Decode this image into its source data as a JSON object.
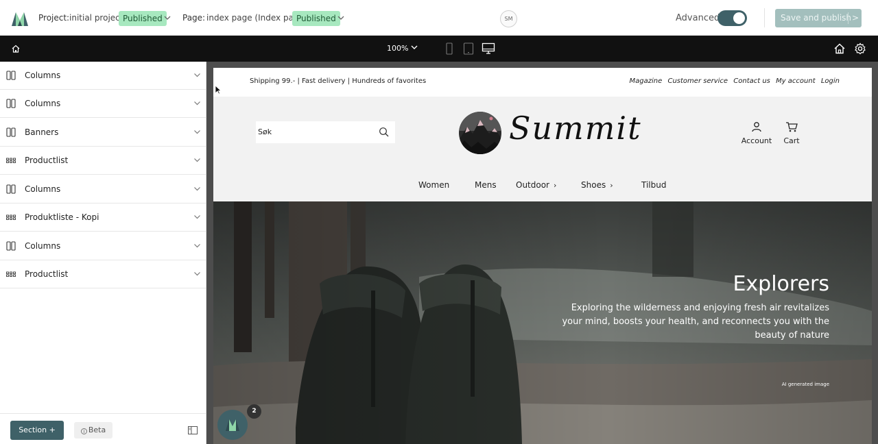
{
  "header": {
    "project_label": "Project:",
    "project_name": "initial project",
    "project_status": "Published",
    "page_label": "Page:",
    "page_name": "index page (Index page)",
    "page_status": "Published",
    "user_initials": "SM",
    "advanced_label": "Advanced",
    "advanced_on": true,
    "publish_label": "Save and publish",
    "publish_arrow": ">"
  },
  "toolbar": {
    "zoom": "100%",
    "devices": [
      "mobile-icon",
      "tablet-icon",
      "desktop-icon"
    ],
    "selected_device": "desktop"
  },
  "sidebar": {
    "sections": [
      {
        "label": "Columns",
        "icon": "columns-icon"
      },
      {
        "label": "Columns",
        "icon": "columns-icon"
      },
      {
        "label": "Banners",
        "icon": "columns-icon"
      },
      {
        "label": "Productlist",
        "icon": "grid-icon"
      },
      {
        "label": "Columns",
        "icon": "columns-icon"
      },
      {
        "label": "Produktliste - Kopi",
        "icon": "grid-icon"
      },
      {
        "label": "Columns",
        "icon": "columns-icon"
      },
      {
        "label": "Productlist",
        "icon": "grid-icon"
      }
    ],
    "section_button": "Section +",
    "beta_button": "Beta"
  },
  "preview": {
    "promo_text": "Shipping 99.- | Fast delivery | Hundreds of favorites",
    "utility_links": [
      "Magazine",
      "Customer service",
      "Contact us",
      "My account",
      "Login"
    ],
    "search_placeholder": "Søk",
    "brand_name": "Summit",
    "account_label": "Account",
    "cart_label": "Cart",
    "nav": [
      {
        "label": "Women",
        "has_children": false
      },
      {
        "label": "Mens",
        "has_children": false
      },
      {
        "label": "Outdoor",
        "has_children": true
      },
      {
        "label": "Shoes",
        "has_children": true
      },
      {
        "label": "Tilbud",
        "has_children": false
      }
    ],
    "hero_title": "Explorers",
    "hero_text": "Exploring the wilderness and enjoying fresh air revitalizes your mind, boosts your health, and reconnects you with the beauty of nature",
    "hero_note": "AI generated image"
  },
  "notification_count": "2",
  "colors": {
    "accent": "#3f6168",
    "badge": "#a7e8bf",
    "toolbar": "#111111",
    "publish_disabled": "#a3bfbd"
  }
}
